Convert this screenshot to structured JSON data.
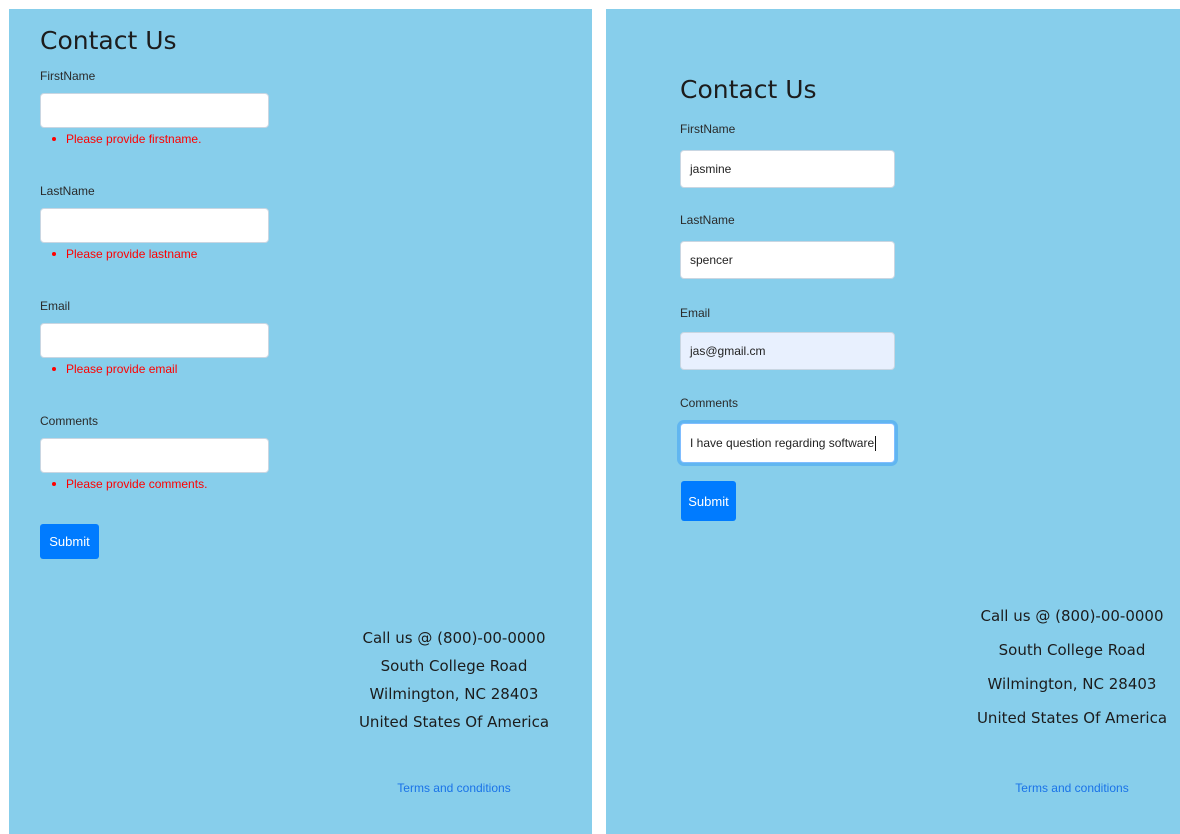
{
  "left": {
    "title": "Contact Us",
    "fields": [
      {
        "label": "FirstName",
        "value": "",
        "error": "Please provide firstname."
      },
      {
        "label": "LastName",
        "value": "",
        "error": "Please provide lastname"
      },
      {
        "label": "Email",
        "value": "",
        "error": "Please provide email"
      },
      {
        "label": "Comments",
        "value": "",
        "error": "Please provide comments."
      }
    ],
    "submit_label": "Submit",
    "footer": {
      "lines": [
        "Call us @ (800)-00-0000",
        "South College Road",
        "Wilmington, NC 28403",
        "United States Of America"
      ],
      "terms_label": "Terms and conditions"
    }
  },
  "right": {
    "title": "Contact Us",
    "fields": [
      {
        "label": "FirstName",
        "value": "jasmine"
      },
      {
        "label": "LastName",
        "value": "spencer"
      },
      {
        "label": "Email",
        "value": "jas@gmail.cm"
      },
      {
        "label": "Comments",
        "value": "I have question regarding software"
      }
    ],
    "submit_label": "Submit",
    "footer": {
      "lines": [
        "Call us @ (800)-00-0000",
        "South College Road",
        "Wilmington, NC 28403",
        "United States Of America"
      ],
      "terms_label": "Terms and conditions"
    }
  },
  "colors": {
    "panel_background": "#87ceeb",
    "primary_button": "#007bff",
    "error_text": "#ff0000",
    "link_text": "#1a73e8",
    "autofill_background": "#e8f0fe"
  }
}
